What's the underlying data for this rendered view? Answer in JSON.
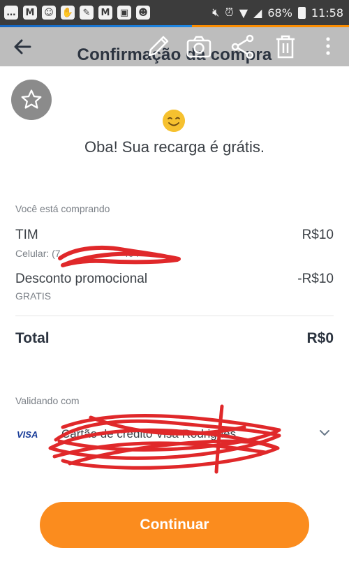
{
  "status_bar": {
    "left_icons": [
      "message-icon",
      "gmail-icon",
      "face-icon",
      "hands-icon",
      "feather-icon",
      "gmail-icon",
      "gallery-icon",
      "emoji-icon"
    ],
    "battery": "68%",
    "time": "11:58"
  },
  "toolbar": {
    "title": "Confirmação da compra",
    "icons": [
      "pencil-icon",
      "camera-icon",
      "share-icon",
      "trash-icon",
      "more-vert-icon"
    ]
  },
  "main": {
    "headline": "Oba! Sua recarga é grátis.",
    "section_label": "Você está comprando",
    "items": [
      {
        "name": "TIM",
        "sub": "Celular: (7",
        "sub_tail": "404",
        "value": "R$10"
      },
      {
        "name": "Desconto promocional",
        "sub": "GRATIS",
        "value": "-R$10"
      }
    ],
    "total_label": "Total",
    "total_value": "R$0"
  },
  "payment": {
    "label": "Validando com",
    "brand": "VISA",
    "card_name": "Cartão de crédito Visa Rodrigues"
  },
  "cta": {
    "label": "Continuar"
  },
  "colors": {
    "accent_orange": "#fb8c1e",
    "toolbar_gray": "#bdbdbd",
    "redaction_red": "#e0282a"
  }
}
